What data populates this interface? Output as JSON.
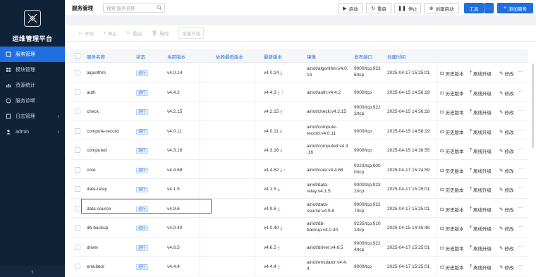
{
  "app": {
    "title": "运维管理平台"
  },
  "sidebar": {
    "items": [
      {
        "label": "服务管理",
        "icon": "service-icon",
        "active": true
      },
      {
        "label": "模块管理",
        "icon": "module-icon"
      },
      {
        "label": "资源统计",
        "icon": "chart-icon"
      },
      {
        "label": "服务诊断",
        "icon": "diagnose-icon"
      },
      {
        "label": "日志管理",
        "icon": "log-icon",
        "arrow": "›"
      },
      {
        "label": "admin",
        "icon": "user-icon",
        "arrow": "›"
      }
    ],
    "collapse": "‹"
  },
  "header": {
    "title": "服务管理",
    "search_placeholder": "搜索 服务名称",
    "buttons": {
      "start": "启动",
      "restart": "重启",
      "stop": "停止",
      "create_start": "创建启动",
      "tools": "工具",
      "tools_more": "···",
      "add_service": "添加服务"
    }
  },
  "toolbar": {
    "start": "开始",
    "stop": "停止",
    "restart": "重启",
    "delete": "删除",
    "batch_upgrade": "批量升级"
  },
  "table": {
    "columns": {
      "name": "服务名称",
      "status": "状态",
      "current_version": "当前版本",
      "min_dep_version": "依赖最低版本",
      "latest_version": "最新版本",
      "image": "镜像",
      "port": "发布端口",
      "created": "创建时间"
    },
    "actions": {
      "history": "历史版本",
      "offline_upgrade": "离线升级",
      "edit": "修改",
      "more": "···"
    },
    "rows": [
      {
        "name": "algorithm",
        "status": "运行",
        "current": "v4.0.14",
        "latest": "v4.0.14",
        "image": [
          "airiot/algorithm:v4.0.",
          "14"
        ],
        "port": [
          "9000/tcp,923",
          "6/tcp"
        ],
        "created": "2025-04-17 15:25:01"
      },
      {
        "name": "auth",
        "status": "运行",
        "current": "v4.4.2",
        "latest": "v4.4.3",
        "latest_up": true,
        "image": [
          "airiot/auth:v4.4.2"
        ],
        "port": [
          "9000/tcp"
        ],
        "created": "2025-04-15 14:56:19"
      },
      {
        "name": "check",
        "status": "运行",
        "current": "v4.2.15",
        "latest": "v4.2.15",
        "image": [
          "airiot/check:v4.2.15"
        ],
        "port": [
          "9000/tcp,922",
          "3/tcp"
        ],
        "created": "2025-04-15 14:56:18"
      },
      {
        "name": "compute-record",
        "status": "运行",
        "current": "v4.0.11",
        "latest": "v4.0.11",
        "image": [
          "airiot/compute-",
          "record:v4.0.11"
        ],
        "port": [
          "9000/tcp"
        ],
        "created": "2025-04-15 14:56:19"
      },
      {
        "name": "computed",
        "status": "运行",
        "current": "v4.3.16",
        "latest": "v4.3.16",
        "image": [
          "airiot/computed:v4.3",
          ".16"
        ],
        "port": [
          "9000/tcp"
        ],
        "created": "2025-04-15 14:38:55"
      },
      {
        "name": "core",
        "status": "运行",
        "current": "v4.4.68",
        "latest": "v4.4.62",
        "latest_up": true,
        "image": [
          "airiot/core:v4.4.68"
        ],
        "port": [
          "9223/tcp,900",
          "0/tcp"
        ],
        "created": "2025-04-17 15:24:59"
      },
      {
        "name": "data-relay",
        "status": "运行",
        "current": "v4.1.5",
        "latest": "v4.1.5",
        "image": [
          "airiot/data-",
          "relay:v4.1.5"
        ],
        "port": [
          "9000/tcp,923",
          "2/tcp"
        ],
        "created": "2025-04-17 15:25:01"
      },
      {
        "name": "data-source",
        "status": "运行",
        "current": "v4.9.6",
        "latest": "v4.9.6",
        "image": [
          "airiot/data-",
          "source:v4.9.6"
        ],
        "port": [
          "9000/tcp,922",
          "7/tcp"
        ],
        "created": "2025-04-17 15:25:01"
      },
      {
        "name": "db-backup",
        "status": "运行",
        "current": "v4.0.40",
        "latest": "v4.0.40",
        "image": [
          "airiot/db-",
          "backup:v4.0.40"
        ],
        "port": [
          "9235/tcp,910",
          "2/tcp"
        ],
        "created": "2025-04-15 14:45:48"
      },
      {
        "name": "driver",
        "status": "运行",
        "current": "v4.6.5",
        "latest": "v4.6.5",
        "image": [
          "airiot/driver:v4.6.5"
        ],
        "port": [
          "9000/tcp,922",
          "4/tcp"
        ],
        "created": "2025-04-17 15:25:01"
      },
      {
        "name": "emulator",
        "status": "运行",
        "current": "v4.4.4",
        "latest": "v4.4.4",
        "image": [
          "airiot/emulator:v4.4.",
          "4"
        ],
        "port": [
          "9000/tcp"
        ],
        "created": "2025-04-17 15:25:01"
      }
    ]
  },
  "colors": {
    "accent": "#1f6fde",
    "sidebar_bg": "#0f2238",
    "highlight": "#e53935"
  }
}
